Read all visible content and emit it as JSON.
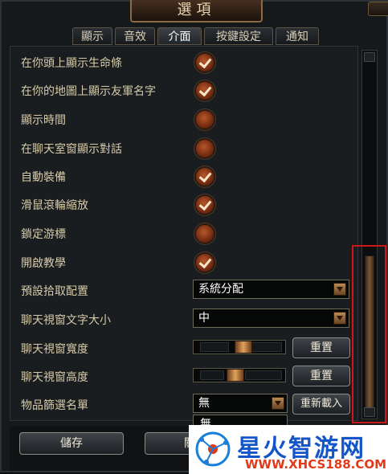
{
  "window": {
    "title": "選項"
  },
  "tabs": [
    {
      "label": "顯示",
      "active": false
    },
    {
      "label": "音效",
      "active": false
    },
    {
      "label": "介面",
      "active": true
    },
    {
      "label": "按鍵設定",
      "active": false
    },
    {
      "label": "通知",
      "active": false
    }
  ],
  "settings": {
    "show_hp_above_head": {
      "label": "在你頭上顯示生命條",
      "checked": true
    },
    "show_ally_names_map": {
      "label": "在你的地圖上顯示友軍名字",
      "checked": true
    },
    "show_time": {
      "label": "顯示時間",
      "checked": false
    },
    "show_dialog_chat": {
      "label": "在聊天室窗顯示對話",
      "checked": false
    },
    "auto_equip": {
      "label": "自動裝備",
      "checked": true
    },
    "wheel_zoom": {
      "label": "滑鼠滾輪縮放",
      "checked": true
    },
    "lock_cursor": {
      "label": "鎖定游標",
      "checked": false
    },
    "enable_tutorial": {
      "label": "開啟教學",
      "checked": true
    },
    "loot_config": {
      "label": "預設拾取配置",
      "value": "系統分配"
    },
    "chat_font_size": {
      "label": "聊天視窗文字大小",
      "value": "中"
    },
    "chat_width": {
      "label": "聊天視窗寬度",
      "level": 0.55,
      "reset_label": "重置"
    },
    "chat_height": {
      "label": "聊天視窗高度",
      "level": 0.45,
      "reset_label": "重置"
    },
    "item_filter": {
      "label": "物品篩選名單",
      "value": "無",
      "reload_label": "重新載入",
      "option": "無"
    }
  },
  "footer": {
    "save_label": "儲存",
    "close_partial": "關"
  },
  "watermark": {
    "brand": "星火智游网",
    "url": "WWW.XHCS188.COM"
  },
  "colors": {
    "accent": "#b6582a",
    "label": "#d5caa8",
    "highlight": "#d01717"
  }
}
